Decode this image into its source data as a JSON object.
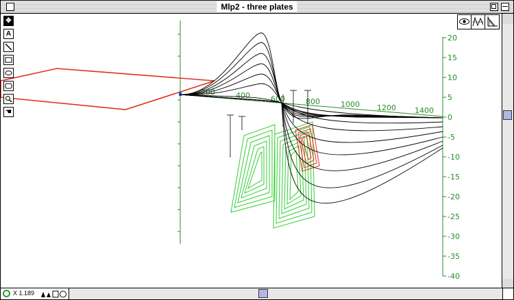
{
  "window": {
    "title": "Mlp2 - three plates"
  },
  "toolbox": [
    {
      "name": "pointer-tool",
      "icon": "pointer-icon"
    },
    {
      "name": "text-tool",
      "icon": "text-a-icon",
      "label": "A"
    },
    {
      "name": "line-tool",
      "icon": "line-icon"
    },
    {
      "name": "rectangle-tool",
      "icon": "rectangle-icon"
    },
    {
      "name": "oval-tool",
      "icon": "oval-icon"
    },
    {
      "name": "rounded-rect-tool",
      "icon": "rounded-rect-icon"
    },
    {
      "name": "zoom-tool",
      "icon": "magnifier-icon"
    },
    {
      "name": "hand-tool",
      "icon": "hand-icon"
    }
  ],
  "view_buttons": [
    {
      "name": "view-eye-button",
      "icon": "eye-icon"
    },
    {
      "name": "view-wave-button",
      "icon": "wave-icon"
    },
    {
      "name": "view-axes-button",
      "icon": "axes-icon"
    }
  ],
  "status": {
    "zoom_text": "X 1.189"
  },
  "axes": {
    "x_tick_labels": [
      "200",
      "400",
      "600",
      "800",
      "1000",
      "1200",
      "1400"
    ],
    "z_tick_labels": [
      "20",
      "15",
      "10",
      "5",
      "0",
      "-5",
      "-10",
      "-15",
      "-20",
      "-25",
      "-30",
      "-35",
      "-40"
    ]
  },
  "colors": {
    "axis": "#2a8a2a",
    "plate_green": "#33cc33",
    "plate_red": "#e03020",
    "curves": "#000000",
    "scroll_thumb": "#b0b8e8"
  }
}
